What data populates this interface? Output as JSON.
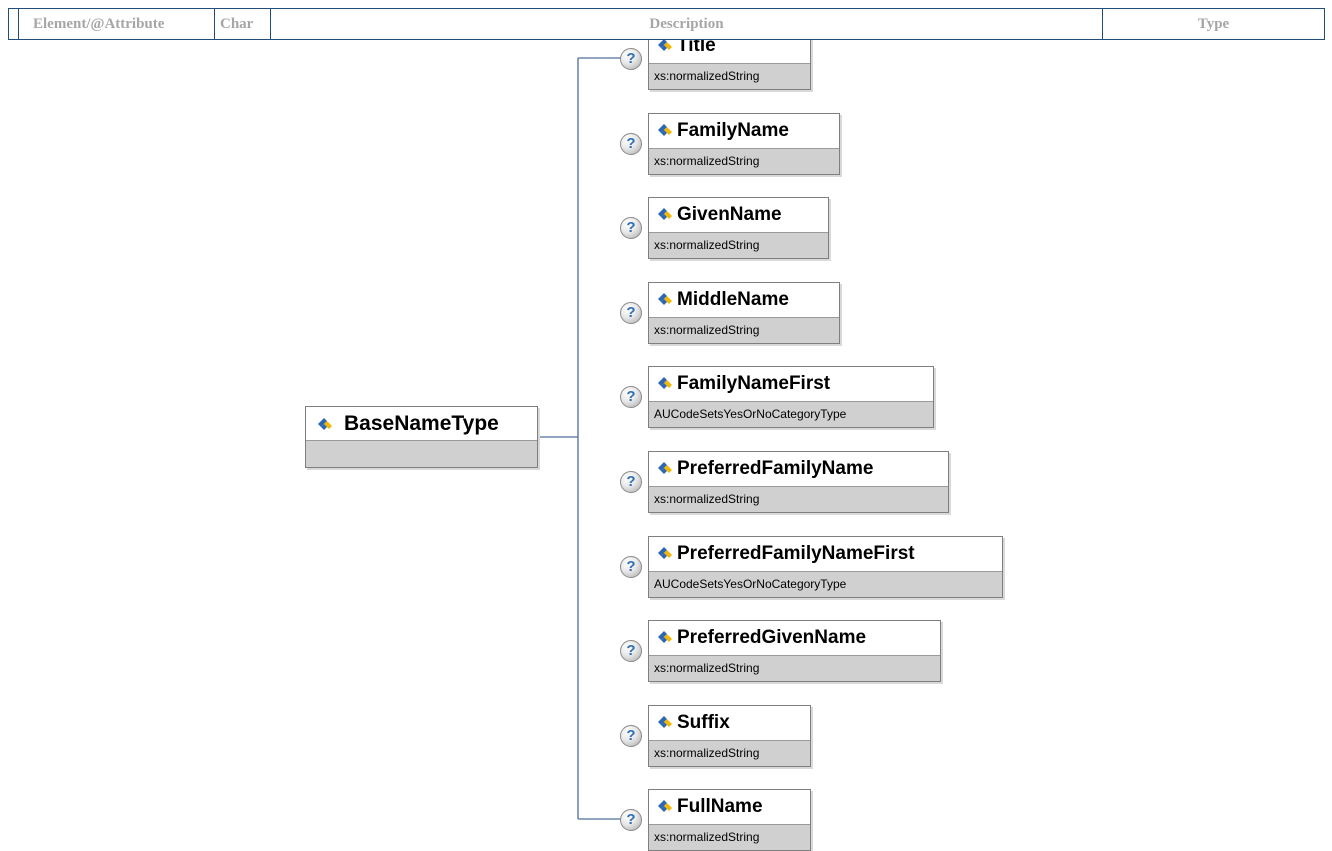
{
  "table_header": {
    "columns": [
      "",
      "Element/@Attribute",
      "Char",
      "Description",
      "Type"
    ]
  },
  "root": {
    "name": "BaseNameType",
    "type": ""
  },
  "children": [
    {
      "name": "Title",
      "type": "xs:normalizedString"
    },
    {
      "name": "FamilyName",
      "type": "xs:normalizedString"
    },
    {
      "name": "GivenName",
      "type": "xs:normalizedString"
    },
    {
      "name": "MiddleName",
      "type": "xs:normalizedString"
    },
    {
      "name": "FamilyNameFirst",
      "type": "AUCodeSetsYesOrNoCategoryType"
    },
    {
      "name": "PreferredFamilyName",
      "type": "xs:normalizedString"
    },
    {
      "name": "PreferredFamilyNameFirst",
      "type": "AUCodeSetsYesOrNoCategoryType"
    },
    {
      "name": "PreferredGivenName",
      "type": "xs:normalizedString"
    },
    {
      "name": "Suffix",
      "type": "xs:normalizedString"
    },
    {
      "name": "FullName",
      "type": "xs:normalizedString"
    }
  ],
  "help_glyph": "?",
  "icons": {
    "element": "element-icon",
    "help": "help-icon"
  },
  "colors": {
    "header_border": "#1f4e79",
    "header_text": "#a6a6a6",
    "connector": "#4f6d9a",
    "type_bar": "#d0d0d0",
    "icon_blue": "#2e67b1",
    "icon_gold": "#f2b705"
  }
}
